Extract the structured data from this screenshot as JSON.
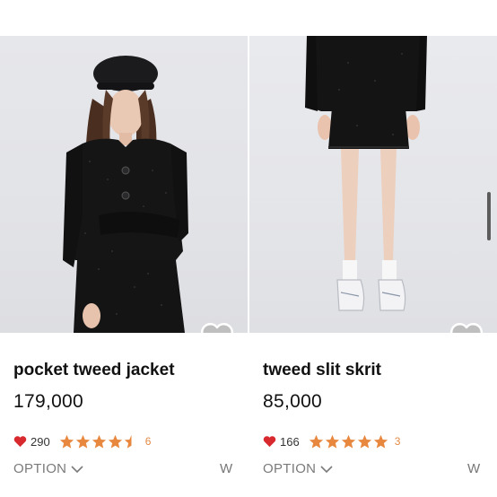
{
  "products": [
    {
      "name": "pocket tweed jacket",
      "price": "179,000",
      "likes": "290",
      "rating": 4.5,
      "review_count": "6",
      "option_label": "OPTION",
      "w_label": "W",
      "icon_wish": "heart-outline-icon",
      "icon_like": "heart-icon",
      "icon_option": "chevron-down-icon"
    },
    {
      "name": "tweed slit skrit",
      "price": "85,000",
      "likes": "166",
      "rating": 5,
      "review_count": "3",
      "option_label": "OPTION",
      "w_label": "W",
      "icon_wish": "heart-outline-icon",
      "icon_like": "heart-icon",
      "icon_option": "chevron-down-icon"
    }
  ],
  "colors": {
    "heart_red": "#d8292f",
    "star_orange": "#e8883f",
    "text_gray": "#7a7a7a",
    "wish_heart": "#bdbdbd"
  }
}
